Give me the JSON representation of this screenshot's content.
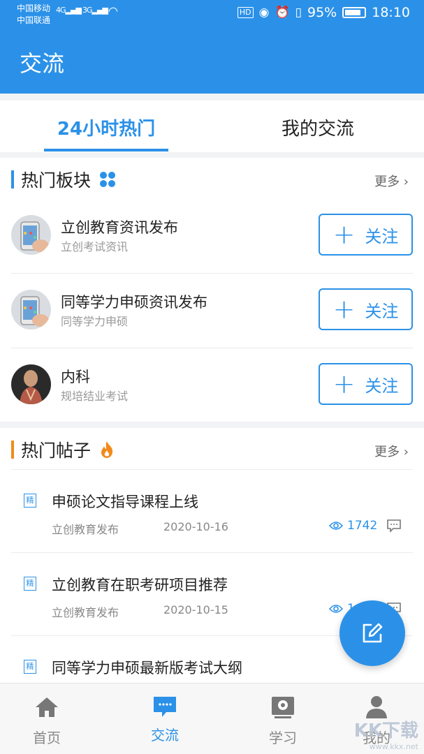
{
  "status_bar": {
    "carrier1": "中国移动",
    "carrier2": "中国联通",
    "sig1": "4G",
    "sig2": "3G",
    "hd": "HD",
    "battery": "95%",
    "time": "18:10"
  },
  "app_bar": {
    "title": "交流"
  },
  "tabs": [
    {
      "label": "24小时热门",
      "active": true
    },
    {
      "label": "我的交流",
      "active": false
    }
  ],
  "hot_boards": {
    "title": "热门板块",
    "more": "更多 ›",
    "items": [
      {
        "name": "立创教育资讯发布",
        "subtitle": "立创考试资讯",
        "follow_label": "关注"
      },
      {
        "name": "同等学力申硕资讯发布",
        "subtitle": "同等学力申硕",
        "follow_label": "关注"
      },
      {
        "name": "内科",
        "subtitle": "规培结业考试",
        "follow_label": "关注"
      }
    ]
  },
  "hot_posts": {
    "title": "热门帖子",
    "more": "更多 ›",
    "items": [
      {
        "badge": "精",
        "title": "申硕论文指导课程上线",
        "author": "立创教育发布",
        "date": "2020-10-16",
        "views": "1742"
      },
      {
        "badge": "精",
        "title": "立创教育在职考研项目推荐",
        "author": "立创教育发布",
        "date": "2020-10-15",
        "views": "1"
      },
      {
        "badge": "精",
        "title": "同等学力申硕最新版考试大纲"
      }
    ]
  },
  "bottom_nav": [
    {
      "label": "首页",
      "icon": "home-icon",
      "active": false
    },
    {
      "label": "交流",
      "icon": "chat-icon",
      "active": true
    },
    {
      "label": "学习",
      "icon": "study-icon",
      "active": false
    },
    {
      "label": "我的",
      "icon": "profile-icon",
      "active": false
    }
  ],
  "watermark": {
    "main": "KK下载",
    "sub": "www.kkx.net"
  },
  "colors": {
    "primary": "#2b91e8",
    "accent_orange": "#f28a1b"
  }
}
